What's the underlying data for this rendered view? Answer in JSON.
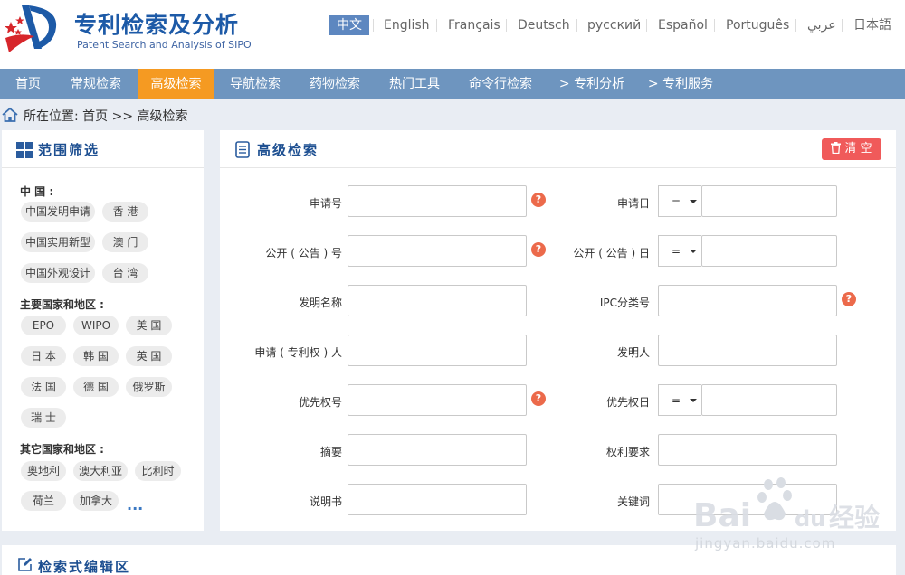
{
  "header": {
    "title": "专利检索及分析",
    "subtitle": "Patent Search and Analysis of SIPO",
    "languages": [
      "中文",
      "English",
      "Français",
      "Deutsch",
      "русский",
      "Español",
      "Português",
      "عربي",
      "日本語"
    ]
  },
  "nav": {
    "items": [
      "首页",
      "常规检索",
      "高级检索",
      "导航检索",
      "药物检索",
      "热门工具",
      "命令行检索",
      "> 专利分析",
      "> 专利服务"
    ],
    "active": "高级检索"
  },
  "breadcrumb": {
    "text": "所在位置: 首页 >> 高级检索"
  },
  "scope": {
    "title": "范围筛选",
    "groups": [
      {
        "label": "中 国 :",
        "tags": [
          "中国发明申请",
          "香 港",
          "中国实用新型",
          "澳 门",
          "中国外观设计",
          "台 湾"
        ]
      },
      {
        "label": "主要国家和地区 :",
        "tags": [
          "EPO",
          "WIPO",
          "美 国",
          "日 本",
          "韩 国",
          "英 国",
          "法 国",
          "德 国",
          "俄罗斯",
          "瑞 士"
        ]
      },
      {
        "label": "其它国家和地区 :",
        "tags": [
          "奥地利",
          "澳大利亚",
          "比利时",
          "荷兰",
          "加拿大"
        ]
      }
    ],
    "more": "..."
  },
  "search": {
    "title": "高级检索",
    "clear_label": "清 空",
    "operator": "=",
    "help_glyph": "?",
    "fields": [
      {
        "label": "申请号",
        "value": ""
      },
      {
        "label": "申请日",
        "value": ""
      },
      {
        "label": "公开 ( 公告 ) 号",
        "value": ""
      },
      {
        "label": "公开 ( 公告 ) 日",
        "value": ""
      },
      {
        "label": "发明名称",
        "value": ""
      },
      {
        "label": "IPC分类号",
        "value": ""
      },
      {
        "label": "申请 ( 专利权 ) 人",
        "value": ""
      },
      {
        "label": "发明人",
        "value": ""
      },
      {
        "label": "优先权号",
        "value": ""
      },
      {
        "label": "优先权日",
        "value": ""
      },
      {
        "label": "摘要",
        "value": ""
      },
      {
        "label": "权利要求",
        "value": ""
      },
      {
        "label": "说明书",
        "value": ""
      },
      {
        "label": "关键词",
        "value": ""
      }
    ]
  },
  "editor": {
    "title": "检索式编辑区"
  },
  "watermark": {
    "brand": "Bai du 经验",
    "url": "jingyan.baidu.com"
  },
  "colors": {
    "brand_blue": "#1d5aa7",
    "nav_bg": "#6e95bf",
    "nav_active": "#f59a22",
    "clear_button": "#f05a5a",
    "help_badge": "#ec6a4b"
  }
}
